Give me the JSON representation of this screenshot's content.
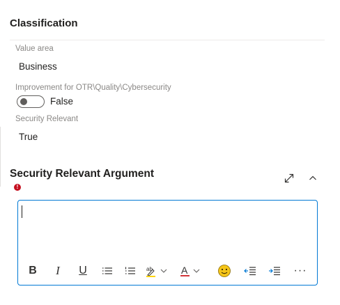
{
  "section": {
    "title": "Classification"
  },
  "fields": {
    "value_area": {
      "label": "Value area",
      "value": "Business"
    },
    "improvement": {
      "label": "Improvement for OTR\\Quality\\Cybersecurity",
      "value": "False"
    },
    "security_relevant": {
      "label": "Security Relevant",
      "value": "True"
    }
  },
  "argument": {
    "title": "Security Relevant Argument",
    "required_mark": "!",
    "text": ""
  },
  "toolbar": {
    "bold": "B",
    "italic": "I",
    "underline": "U",
    "font_color_letter": "A",
    "more": "···",
    "icons": [
      "bold-icon",
      "italic-icon",
      "underline-icon",
      "bulleted-list-icon",
      "numbered-list-icon",
      "highlight-icon",
      "font-color-icon",
      "emoji-icon",
      "decrease-indent-icon",
      "increase-indent-icon",
      "more-icon"
    ],
    "colors": {
      "highlight": "#ffd400",
      "font_color": "#d13438",
      "emoji": "#f5c518",
      "focus_border": "#0078d4",
      "required": "#c50f1f"
    }
  }
}
